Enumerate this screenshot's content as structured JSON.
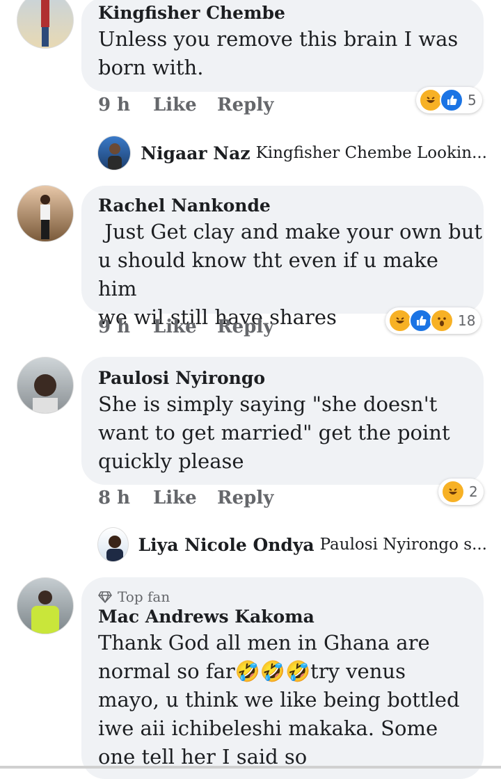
{
  "comments": [
    {
      "author": "Kingfisher Chembe",
      "lines": [
        "Unless you remove this brain I was",
        "born with."
      ],
      "time": "9 h",
      "like": "Like",
      "reply": "Reply",
      "reaction_count": "5",
      "reply_preview": {
        "author": "Nigaar Naz",
        "text": "Kingfisher Chembe Lookin..."
      }
    },
    {
      "author": "Rachel Nankonde",
      "lines": [
        " Just Get clay and make your own but",
        "u should know tht even if u make him",
        "we wil still have shares"
      ],
      "time": "9 h",
      "like": "Like",
      "reply": "Reply",
      "reaction_count": "18"
    },
    {
      "author": "Paulosi Nyirongo",
      "lines": [
        "She is simply saying \"she doesn't",
        "want to get married\" get the point",
        "quickly please"
      ],
      "time": "8 h",
      "like": "Like",
      "reply": "Reply",
      "reaction_count": "2",
      "reply_preview": {
        "author": "Liya Nicole Ondya",
        "text": "Paulosi Nyirongo s..."
      }
    },
    {
      "badge": "Top fan",
      "author": "Mac Andrews Kakoma",
      "lines": [
        "Thank God all men in Ghana are",
        "normal so far🤣🤣🤣try venus",
        "mayo, u think we like being bottled",
        "iwe aii ichibeleshi makaka. Some",
        "one tell her I said so"
      ]
    }
  ],
  "icons": {
    "reactions": [
      "haha",
      "like",
      "wow"
    ],
    "badge": "diamond-icon"
  },
  "colors": {
    "bubble": "#f0f2f5",
    "meta": "#65676b",
    "like_blue": "#1b74e4",
    "haha_yellow": "#f7b125"
  }
}
